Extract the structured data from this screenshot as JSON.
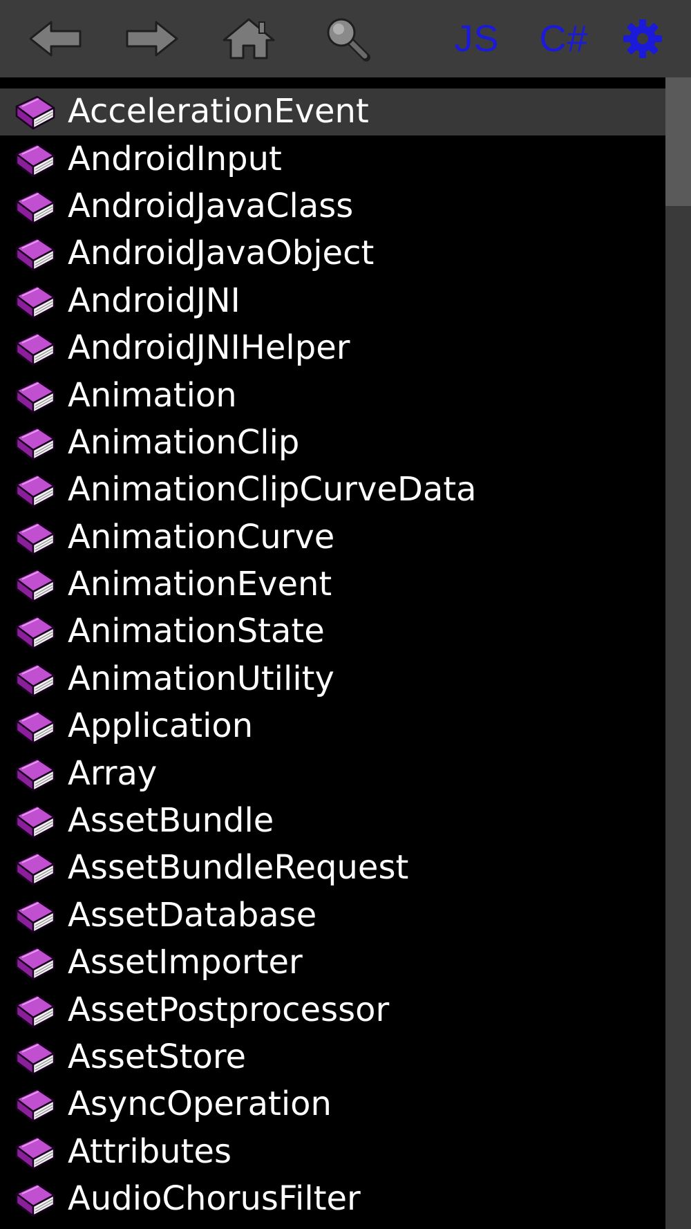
{
  "toolbar": {
    "back_icon": "back-arrow-icon",
    "forward_icon": "forward-arrow-icon",
    "home_icon": "home-icon",
    "search_icon": "search-icon",
    "js_label": "JS",
    "cs_label": "C#",
    "settings_icon": "gear-icon",
    "accent_color": "#1a1ad8"
  },
  "list": {
    "item_icon": "book-icon",
    "selected_index": 0,
    "items": [
      "AccelerationEvent",
      "AndroidInput",
      "AndroidJavaClass",
      "AndroidJavaObject",
      "AndroidJNI",
      "AndroidJNIHelper",
      "Animation",
      "AnimationClip",
      "AnimationClipCurveData",
      "AnimationCurve",
      "AnimationEvent",
      "AnimationState",
      "AnimationUtility",
      "Application",
      "Array",
      "AssetBundle",
      "AssetBundleRequest",
      "AssetDatabase",
      "AssetImporter",
      "AssetPostprocessor",
      "AssetStore",
      "AsyncOperation",
      "Attributes",
      "AudioChorusFilter"
    ]
  }
}
